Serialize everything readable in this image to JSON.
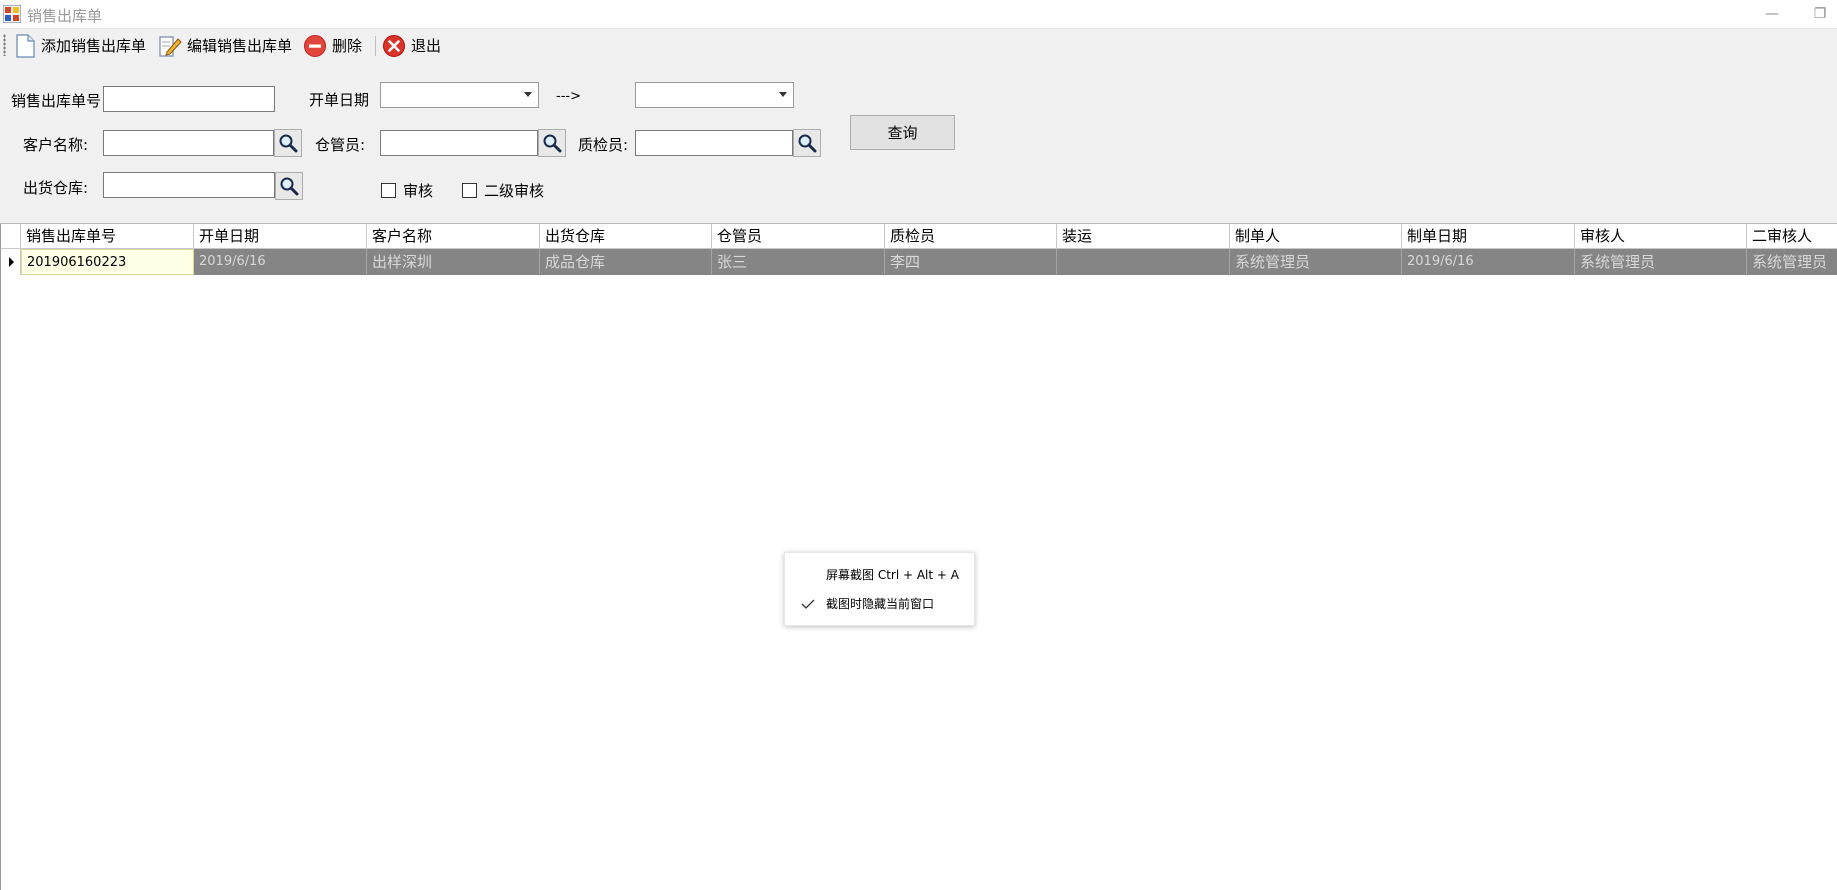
{
  "window": {
    "title": "销售出库单",
    "minimize_glyph": "—",
    "restore_glyph": "❐"
  },
  "toolbar": {
    "add_label": "添加销售出库单",
    "edit_label": "编辑销售出库单",
    "delete_label": "删除",
    "exit_label": "退出"
  },
  "search": {
    "order_no_label": "销售出库单号",
    "order_no_value": "",
    "date_label": "开单日期",
    "date_from": "",
    "date_to": "",
    "date_arrow": "--->",
    "customer_label": "客户名称:",
    "customer_value": "",
    "keeper_label": "仓管员:",
    "keeper_value": "",
    "inspector_label": "质检员:",
    "inspector_value": "",
    "warehouse_label": "出货仓库:",
    "warehouse_value": "",
    "audit_label": "审核",
    "audit2_label": "二级审核",
    "audit_checked": false,
    "audit2_checked": false,
    "query_label": "查询"
  },
  "grid": {
    "columns": [
      "销售出库单号",
      "开单日期",
      "客户名称",
      "出货仓库",
      "仓管员",
      "质检员",
      "装运",
      "制单人",
      "制单日期",
      "审核人",
      "二审核人"
    ],
    "rows": [
      [
        "201906160223",
        "2019/6/16",
        "出样深圳",
        "成品仓库",
        "张三",
        "李四",
        "",
        "系统管理员",
        "2019/6/16",
        "系统管理员",
        "系统管理员"
      ]
    ]
  },
  "context_menu": {
    "items": [
      {
        "label": "屏幕截图 Ctrl + Alt + A",
        "checked": false
      },
      {
        "label": "截图时隐藏当前窗口",
        "checked": true
      }
    ]
  },
  "colors": {
    "selected_row": "#858585",
    "current_cell": "#ffffe6",
    "panel_bg": "#f0f0f0"
  }
}
